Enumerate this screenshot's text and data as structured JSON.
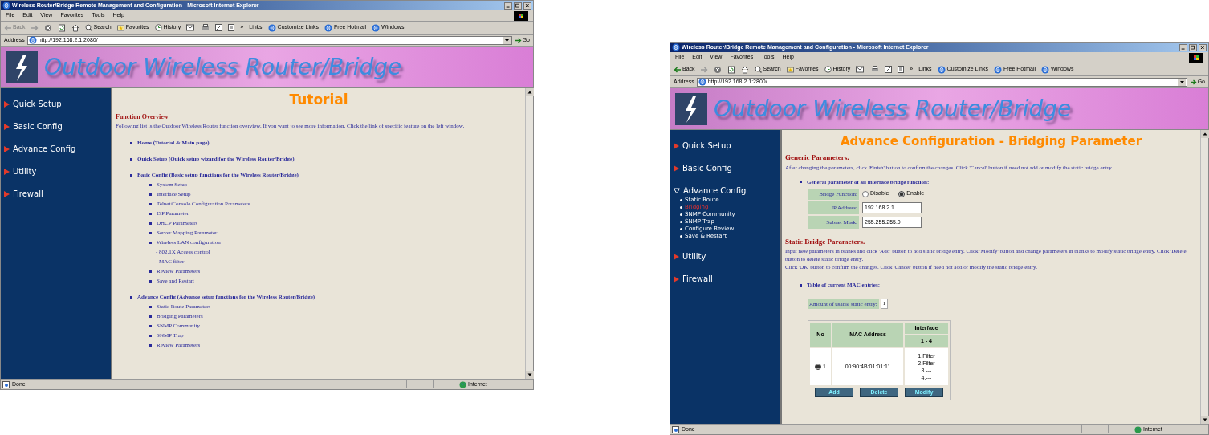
{
  "windows": [
    {
      "title": "Wireless Router/Bridge Remote Management and Configuration - Microsoft Internet Explorer",
      "menu": [
        "File",
        "Edit",
        "View",
        "Favorites",
        "Tools",
        "Help"
      ],
      "back": {
        "label": "Back",
        "disabled": true
      },
      "tools": [
        "Search",
        "Favorites",
        "History"
      ],
      "more": "»",
      "links_label": "Links",
      "links": [
        "Customize Links",
        "Free Hotmail",
        "Windows"
      ],
      "address_label": "Address",
      "address": "http://192.168.2.1:2080/",
      "go": "Go",
      "banner": "Outdoor Wireless Router/Bridge",
      "nav": [
        {
          "label": "Quick Setup",
          "expanded": false
        },
        {
          "label": "Basic Config",
          "expanded": false
        },
        {
          "label": "Advance Config",
          "expanded": false
        },
        {
          "label": "Utility",
          "expanded": false
        },
        {
          "label": "Firewall",
          "expanded": false
        }
      ],
      "content": {
        "kind": "tutorial",
        "title": "Tutorial",
        "heading": "Function Overview",
        "intro": "Following list is the Outdoor Wireless Router function overview. If you want to see more information. Click the link of specific feature on the left window.",
        "items": [
          {
            "label": "Home (Tutorial & Main page)"
          },
          {
            "label": "Quick Setup (Quick setup wizard for the Wireless Router/Bridge)"
          },
          {
            "label": "Basic Config (Basic setup functions for the Wireless Router/Bridge)",
            "children": [
              {
                "label": "System Setup"
              },
              {
                "label": "Interface Setup"
              },
              {
                "label": "Telnet/Console Configuration Parameters"
              },
              {
                "label": "ISP Parameter"
              },
              {
                "label": "DHCP Parameters"
              },
              {
                "label": "Server Mapping Parameter"
              },
              {
                "label": "Wireless LAN configuration",
                "children": [
                  {
                    "label": "- 802.1X Access control"
                  },
                  {
                    "label": "- MAC filter"
                  }
                ]
              },
              {
                "label": "Review Parameters"
              },
              {
                "label": "Save and Restart"
              }
            ]
          },
          {
            "label": "Advance Config (Advance setup functions for the Wireless Router/Bridge)",
            "children": [
              {
                "label": "Static Route Parameters"
              },
              {
                "label": "Bridging Parameters"
              },
              {
                "label": "SNMP Community"
              },
              {
                "label": "SNMP Trap"
              },
              {
                "label": "Review Parameters"
              }
            ]
          }
        ]
      },
      "status": "Done",
      "zone": "Internet"
    },
    {
      "title": "Wireless Router/Bridge Remote Management and Configuration - Microsoft Internet Explorer",
      "menu": [
        "File",
        "Edit",
        "View",
        "Favorites",
        "Tools",
        "Help"
      ],
      "back": {
        "label": "Back",
        "disabled": false
      },
      "tools": [
        "Search",
        "Favorites",
        "History"
      ],
      "more": "»",
      "links_label": "Links",
      "links": [
        "Customize Links",
        "Free Hotmail",
        "Windows"
      ],
      "address_label": "Address",
      "address": "http://192.168.2.1:2800/",
      "go": "Go",
      "banner": "Outdoor Wireless Router/Bridge",
      "nav": [
        {
          "label": "Quick Setup",
          "expanded": false
        },
        {
          "label": "Basic Config",
          "expanded": false
        },
        {
          "label": "Advance Config",
          "expanded": true,
          "children": [
            {
              "label": "Static Route",
              "selected": false
            },
            {
              "label": "Bridging",
              "selected": true
            },
            {
              "label": "SNMP Community",
              "selected": false
            },
            {
              "label": "SNMP Trap",
              "selected": false
            },
            {
              "label": "Configure Review",
              "selected": false
            },
            {
              "label": "Save & Restart",
              "selected": false
            }
          ]
        },
        {
          "label": "Utility",
          "expanded": false
        },
        {
          "label": "Firewall",
          "expanded": false
        }
      ],
      "content": {
        "kind": "bridging",
        "title": "Advance Configuration - Bridging Parameter",
        "heading": "Generic Parameters.",
        "intro": "After changing the parameters, click 'Finish' button to confirm the changes. Click 'Cancel' button if need not add or modify the static bridge entry.",
        "general": "General parameter of all interface bridge function:",
        "bridge_label": "Bridge Function:",
        "options": [
          {
            "label": "Disable",
            "selected": false
          },
          {
            "label": "Enable",
            "selected": true
          }
        ],
        "fields": [
          {
            "label": "IP Address:",
            "value": "192.168.2.1"
          },
          {
            "label": "Subnet Mask:",
            "value": "255.255.255.0"
          }
        ],
        "static_heading": "Static Bridge Parameters.",
        "static_text": [
          "Input new parameters in blanks and click 'Add' button to add static bridge entry. Click 'Modify' button and change parameters in blanks to modify static bridge entry. Click 'Delete' button to delete static bridge entry.",
          "Click 'OK' button to confirm the changes. Click 'Cancel' button if need not add or modify the static bridge entry."
        ],
        "table_bullet": "Table of current MAC entries:",
        "amount_label": "Amount of usable static entry:",
        "amount": "1",
        "columns": [
          "No",
          "MAC Address",
          "Interface",
          "1 - 4"
        ],
        "rows": [
          {
            "selected": true,
            "no": "1",
            "mac": "00:90:4B:01:01:11",
            "interface": [
              "1.Filter",
              "2.Filter",
              "3.---",
              "4.---"
            ]
          }
        ],
        "buttons": [
          "Add",
          "Delete",
          "Modify"
        ]
      },
      "status": "Done",
      "zone": "Internet"
    }
  ]
}
